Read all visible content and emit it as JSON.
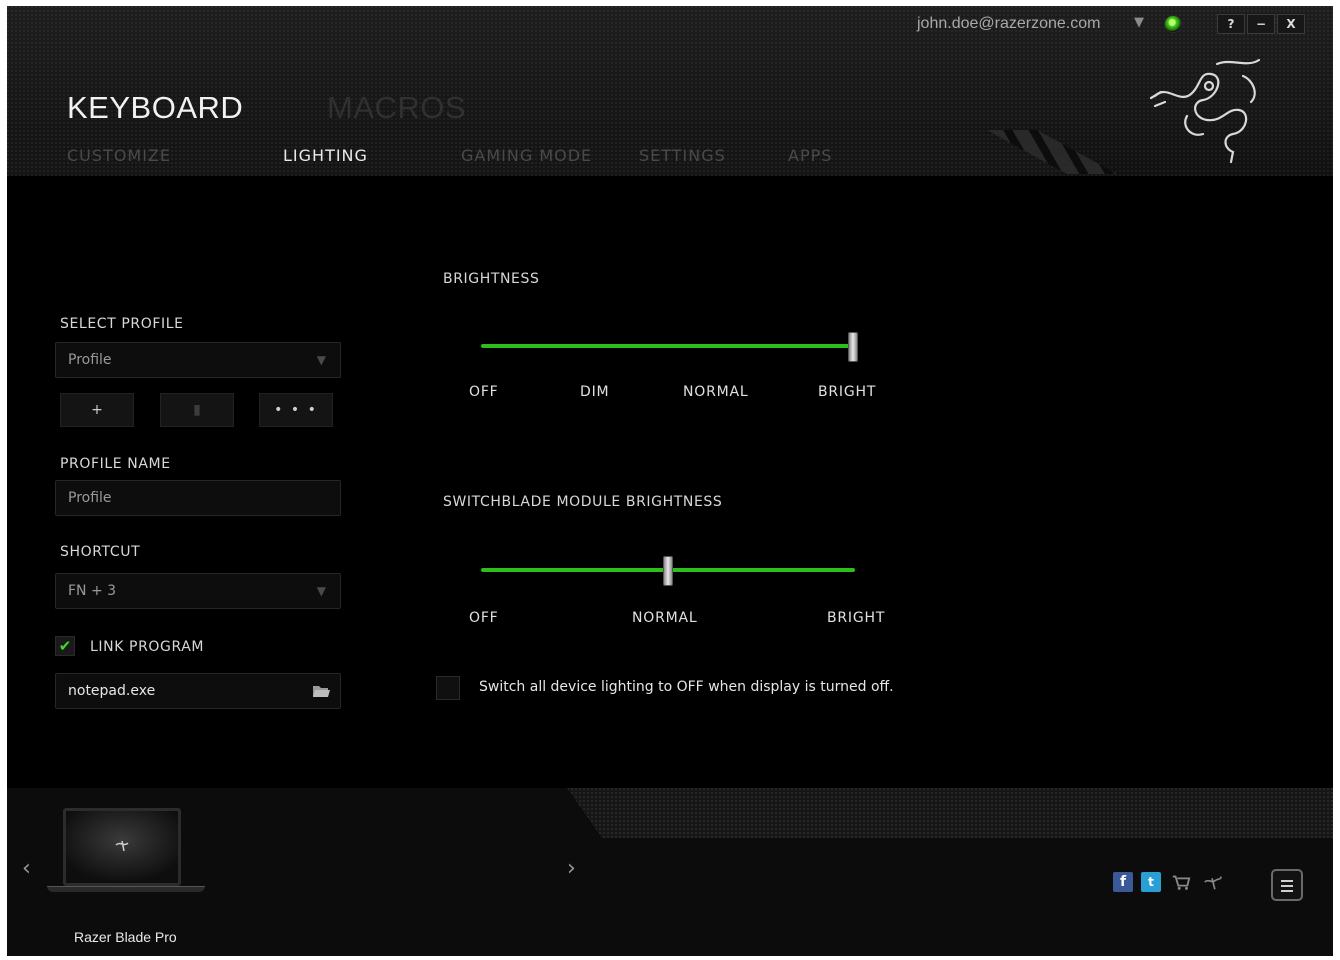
{
  "account": {
    "email": "john.doe@razerzone.com",
    "caret": "▼"
  },
  "window_controls": {
    "help": "?",
    "minimize": "−",
    "close": "X"
  },
  "top_tabs": {
    "active": "KEYBOARD",
    "inactive": "MACROS"
  },
  "sub_tabs": [
    "CUSTOMIZE",
    "LIGHTING",
    "GAMING MODE",
    "SETTINGS",
    "APPS"
  ],
  "sidebar": {
    "select_profile_label": "SELECT PROFILE",
    "profile_select_value": "Profile",
    "add_label": "+",
    "delete_label": "▮",
    "more_label": "• • •",
    "profile_name_label": "PROFILE NAME",
    "profile_name_value": "Profile",
    "shortcut_label": "SHORTCUT",
    "shortcut_value": "FN + 3",
    "link_program_label": "LINK PROGRAM",
    "link_program_checked": true,
    "program_value": "notepad.exe"
  },
  "brightness": {
    "title": "BRIGHTNESS",
    "ticks": [
      "OFF",
      "DIM",
      "NORMAL",
      "BRIGHT"
    ],
    "level_fraction": 1.0
  },
  "switchblade": {
    "title": "SWITCHBLADE MODULE BRIGHTNESS",
    "ticks": [
      "OFF",
      "NORMAL",
      "BRIGHT"
    ],
    "level_fraction": 0.5
  },
  "display_off_option": {
    "label": "Switch all device lighting to OFF when display is turned off.",
    "checked": false
  },
  "footer": {
    "device_name": "Razer Blade Pro",
    "prev_arrow": "‹",
    "next_arrow": "›",
    "social_icons": [
      "facebook-icon",
      "twitter-icon",
      "cart-icon",
      "razer-icon"
    ]
  },
  "colors": {
    "accent_green": "#44d62c",
    "background": "#000000"
  }
}
